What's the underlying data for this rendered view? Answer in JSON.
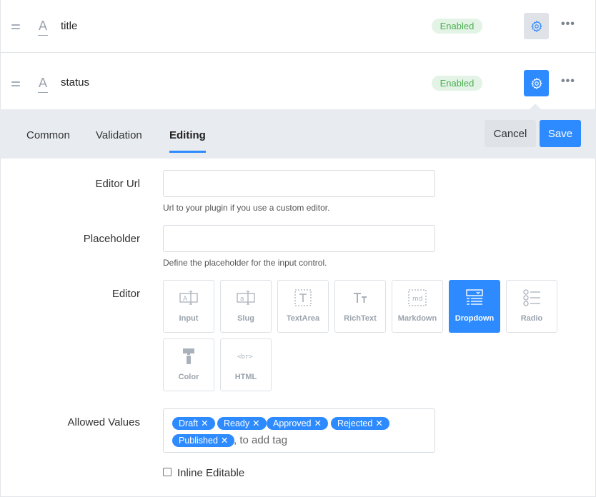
{
  "fields": [
    {
      "name": "title",
      "status": "Enabled"
    },
    {
      "name": "status",
      "status": "Enabled"
    }
  ],
  "tabs": [
    "Common",
    "Validation",
    "Editing"
  ],
  "buttons": {
    "cancel": "Cancel",
    "save": "Save"
  },
  "form": {
    "editor_url": {
      "label": "Editor Url",
      "value": "",
      "hint": "Url to your plugin if you use a custom editor."
    },
    "placeholder": {
      "label": "Placeholder",
      "value": "",
      "hint": "Define the placeholder for the input control."
    },
    "editor": {
      "label": "Editor",
      "options": [
        "Input",
        "Slug",
        "TextArea",
        "RichText",
        "Markdown",
        "Dropdown",
        "Radio",
        "Color",
        "HTML"
      ],
      "selected": "Dropdown"
    },
    "allowed_values": {
      "label": "Allowed Values",
      "tags": [
        "Draft",
        "Ready",
        "Approved",
        "Rejected",
        "Published"
      ],
      "placeholder": ", to add tag"
    },
    "inline_editable": {
      "label": "Inline Editable",
      "checked": false
    }
  },
  "colors": {
    "accent": "#2e8bff",
    "enabled_bg": "#e3f3e6",
    "enabled_text": "#4caf50",
    "tab_bar": "#e8ebef"
  },
  "icons": {
    "type": "text-a-icon",
    "settings": "gear-icon",
    "more": "more-dots-icon",
    "drag": "drag-handle-icon"
  }
}
